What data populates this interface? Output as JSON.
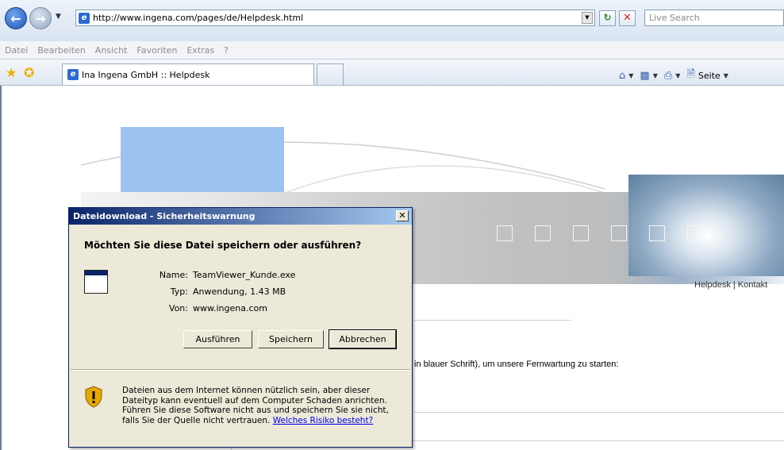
{
  "browser": {
    "url": "http://www.ingena.com/pages/de/Helpdesk.html",
    "search_placeholder": "Live Search",
    "menu": [
      "Datei",
      "Bearbeiten",
      "Ansicht",
      "Favoriten",
      "Extras",
      "?"
    ],
    "tab_title": "Ina Ingena GmbH :: Helpdesk",
    "page_menu_label": "Seite"
  },
  "page": {
    "nav": "Helpdesk | Kontakt",
    "text": "in blauer Schrift), um unsere Fernwartung zu starten:"
  },
  "dialog": {
    "title": "Dateidownload - Sicherheitswarnung",
    "question": "Möchten Sie diese Datei speichern oder ausführen?",
    "name_label": "Name:",
    "name_value": "TeamViewer_Kunde.exe",
    "type_label": "Typ:",
    "type_value": "Anwendung, 1.43 MB",
    "from_label": "Von:",
    "from_value": "www.ingena.com",
    "btn_run": "Ausführen",
    "btn_save": "Speichern",
    "btn_cancel": "Abbrechen",
    "warning_text": "Dateien aus dem Internet können nützlich sein, aber dieser Dateityp kann eventuell auf dem Computer Schaden anrichten. Führen Sie diese Software nicht aus und speichern Sie sie nicht, falls Sie der Quelle nicht vertrauen.",
    "warning_link": "Welches Risiko besteht?"
  },
  "colors": {
    "title_bar": "#0a246a",
    "dialog_bg": "#ece9d8",
    "link": "#0000ee"
  }
}
